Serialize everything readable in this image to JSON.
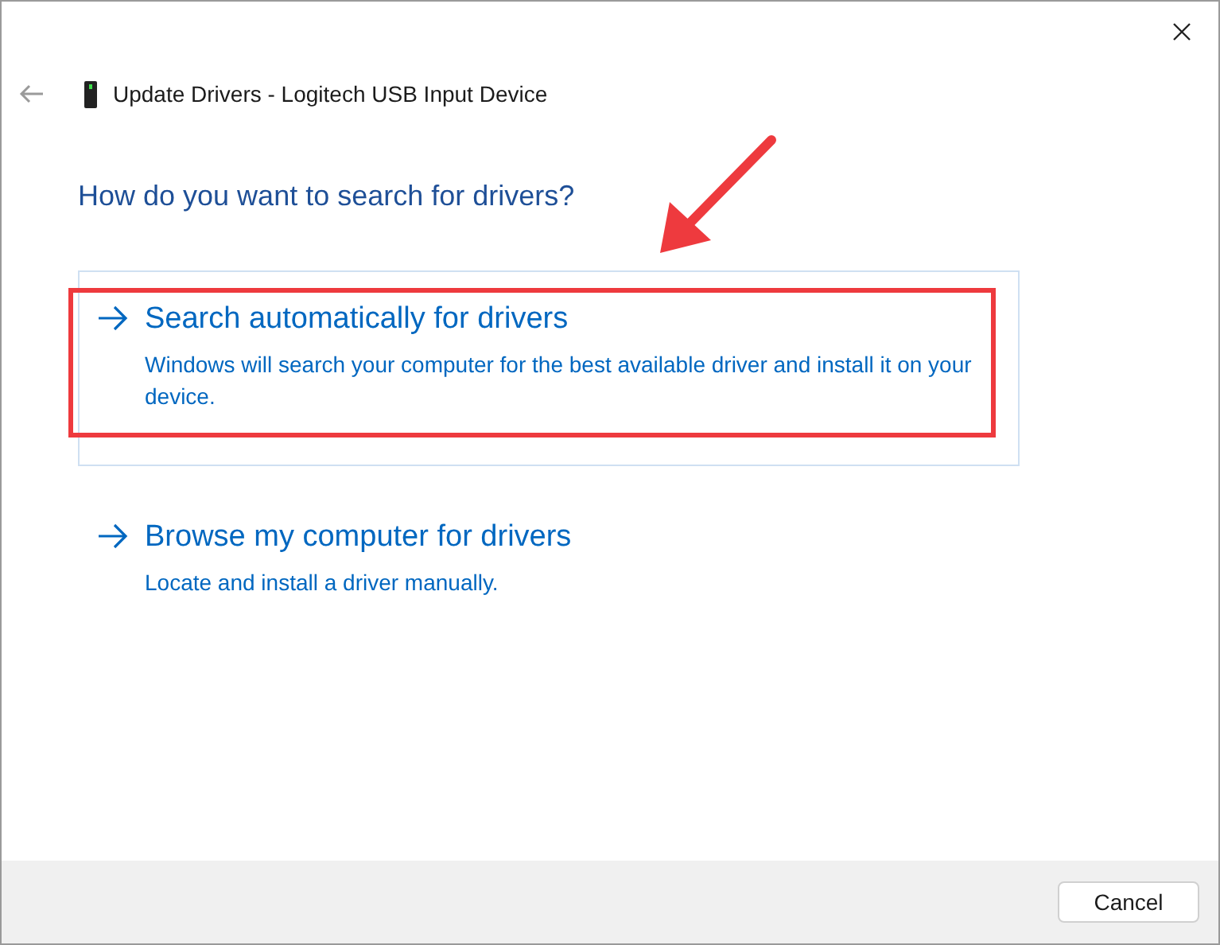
{
  "window": {
    "title": "Update Drivers - Logitech USB Input Device"
  },
  "heading": "How do you want to search for drivers?",
  "options": [
    {
      "title": "Search automatically for drivers",
      "description": "Windows will search your computer for the best available driver and install it on your device.",
      "selected": true
    },
    {
      "title": "Browse my computer for drivers",
      "description": "Locate and install a driver manually.",
      "selected": false
    }
  ],
  "buttons": [
    {
      "label": "Cancel"
    }
  ]
}
